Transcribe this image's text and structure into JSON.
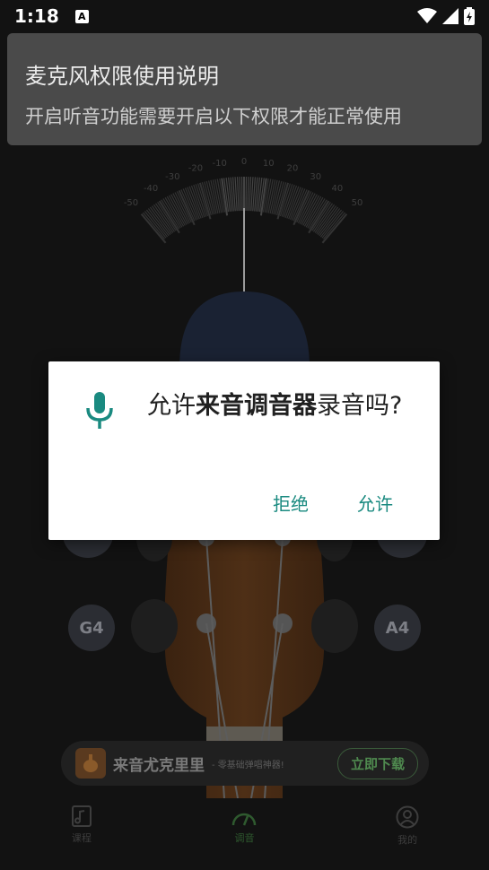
{
  "status_bar": {
    "time": "1:18",
    "notification_icon": "A"
  },
  "permission_banner": {
    "title": "麦克风权限使用说明",
    "description": "开启听音功能需要开启以下权限才能正常使用"
  },
  "gauge": {
    "ticks": [
      "-50",
      "-40",
      "-30",
      "-20",
      "-10",
      "0",
      "10",
      "20",
      "30",
      "40",
      "50"
    ]
  },
  "tuning_pegs": [
    {
      "note": "G4"
    },
    {
      "note": "A4"
    }
  ],
  "ad_banner": {
    "title": "来音尤克里里",
    "subtitle": "- 零基础弹唱神器!",
    "button": "立即下载"
  },
  "bottom_nav": [
    {
      "label": "课程",
      "icon": "course-icon",
      "active": false
    },
    {
      "label": "调音",
      "icon": "tuner-icon",
      "active": true
    },
    {
      "label": "我的",
      "icon": "profile-icon",
      "active": false
    }
  ],
  "dialog": {
    "prefix": "允许",
    "app_name": "来音调音器",
    "suffix": "录音吗?",
    "deny": "拒绝",
    "allow": "允许",
    "accent_color": "#1a8a80"
  }
}
